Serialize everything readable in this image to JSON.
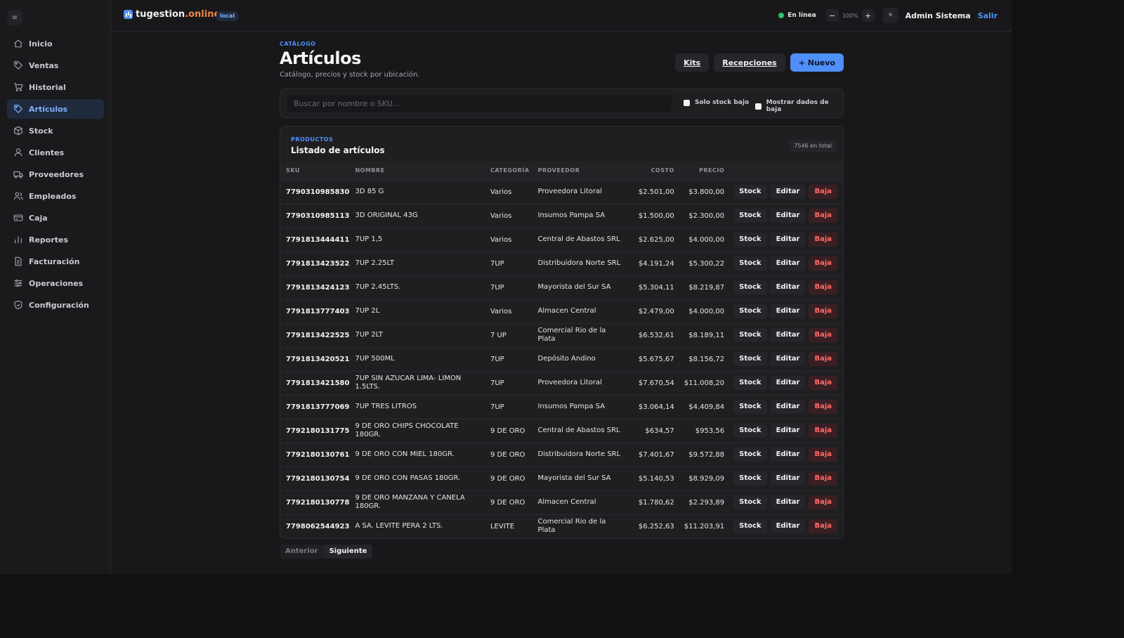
{
  "topbar": {
    "menu_glyph": "≡",
    "brand_a": "tugestion",
    "brand_b": ".online",
    "env": "local",
    "status": "En línea",
    "zoom_out": "−",
    "zoom": "100%",
    "zoom_in": "+",
    "theme_glyph": "☀",
    "user": "Admin Sistema",
    "logout": "Salir"
  },
  "sidebar": {
    "items": [
      {
        "label": "Inicio",
        "icon": "home-icon"
      },
      {
        "label": "Ventas",
        "icon": "tag-icon"
      },
      {
        "label": "Historial",
        "icon": "cart-icon"
      },
      {
        "label": "Artículos",
        "icon": "tag-icon",
        "active": true
      },
      {
        "label": "Stock",
        "icon": "box-icon"
      },
      {
        "label": "Clientes",
        "icon": "user-icon"
      },
      {
        "label": "Proveedores",
        "icon": "truck-icon"
      },
      {
        "label": "Empleados",
        "icon": "users-icon"
      },
      {
        "label": "Caja",
        "icon": "card-icon"
      },
      {
        "label": "Reportes",
        "icon": "chart-icon"
      },
      {
        "label": "Facturación",
        "icon": "file-icon"
      },
      {
        "label": "Operaciones",
        "icon": "sliders-icon"
      },
      {
        "label": "Configuración",
        "icon": "shield-icon"
      }
    ]
  },
  "page": {
    "eyebrow": "CATÁLOGO",
    "title": "Artículos",
    "subtitle": "Catálogo, precios y stock por ubicación.",
    "btn_kits": "Kits",
    "btn_recepciones": "Recepciones",
    "btn_nuevo": "+ Nuevo"
  },
  "filters": {
    "search_placeholder": "Buscar por nombre o SKU...",
    "low_stock": "Solo stock bajo",
    "show_deleted": "Mostrar dados de baja"
  },
  "table": {
    "eyebrow": "PRODUCTOS",
    "title": "Listado de artículos",
    "total": "7546 en total",
    "headers": {
      "sku": "SKU",
      "nombre": "NOMBRE",
      "categoria": "CATEGORÍA",
      "proveedor": "PROVEEDOR",
      "costo": "COSTO",
      "precio": "PRECIO"
    },
    "action_labels": {
      "stock": "Stock",
      "editar": "Editar",
      "baja": "Baja"
    },
    "rows": [
      {
        "sku": "7790310985830",
        "nombre": "3D 85 G",
        "categoria": "Varios",
        "proveedor": "Proveedora Litoral",
        "costo": "$2.501,00",
        "precio": "$3.800,00"
      },
      {
        "sku": "7790310985113",
        "nombre": "3D ORIGINAL 43G",
        "categoria": "Varios",
        "proveedor": "Insumos Pampa SA",
        "costo": "$1.500,00",
        "precio": "$2.300,00"
      },
      {
        "sku": "7791813444411",
        "nombre": "7UP 1,5",
        "categoria": "Varios",
        "proveedor": "Central de Abastos SRL",
        "costo": "$2.625,00",
        "precio": "$4.000,00"
      },
      {
        "sku": "7791813423522",
        "nombre": "7UP 2.25LT",
        "categoria": "7UP",
        "proveedor": "Distribuidora Norte SRL",
        "costo": "$4.191,24",
        "precio": "$5.300,22"
      },
      {
        "sku": "7791813424123",
        "nombre": "7UP 2.45LTS.",
        "categoria": "7UP",
        "proveedor": "Mayorista del Sur SA",
        "costo": "$5.304,11",
        "precio": "$8.219,87"
      },
      {
        "sku": "7791813777403",
        "nombre": "7UP 2L",
        "categoria": "Varios",
        "proveedor": "Almacen Central",
        "costo": "$2.479,00",
        "precio": "$4.000,00"
      },
      {
        "sku": "7791813422525",
        "nombre": "7UP 2LT",
        "categoria": "7 UP",
        "proveedor": "Comercial Rio de la Plata",
        "costo": "$6.532,61",
        "precio": "$8.189,11"
      },
      {
        "sku": "7791813420521",
        "nombre": "7UP 500ML",
        "categoria": "7UP",
        "proveedor": "Depósito Andino",
        "costo": "$5.675,67",
        "precio": "$8.156,72"
      },
      {
        "sku": "7791813421580",
        "nombre": "7UP SIN AZUCAR LIMA- LIMON 1.5LTS.",
        "categoria": "7UP",
        "proveedor": "Proveedora Litoral",
        "costo": "$7.670,54",
        "precio": "$11.008,20"
      },
      {
        "sku": "7791813777069",
        "nombre": "7UP TRES LITROS",
        "categoria": "7UP",
        "proveedor": "Insumos Pampa SA",
        "costo": "$3.064,14",
        "precio": "$4.409,84"
      },
      {
        "sku": "7792180131775",
        "nombre": "9 DE ORO CHIPS CHOCOLATE 180GR.",
        "categoria": "9 DE ORO",
        "proveedor": "Central de Abastos SRL",
        "costo": "$634,57",
        "precio": "$953,56"
      },
      {
        "sku": "7792180130761",
        "nombre": "9 DE ORO CON MIEL 180GR.",
        "categoria": "9 DE ORO",
        "proveedor": "Distribuidora Norte SRL",
        "costo": "$7.401,67",
        "precio": "$9.572,88"
      },
      {
        "sku": "7792180130754",
        "nombre": "9 DE ORO CON PASAS 180GR.",
        "categoria": "9 DE ORO",
        "proveedor": "Mayorista del Sur SA",
        "costo": "$5.140,53",
        "precio": "$8.929,09"
      },
      {
        "sku": "7792180130778",
        "nombre": "9 DE ORO MANZANA Y CANELA 180GR.",
        "categoria": "9 DE ORO",
        "proveedor": "Almacen Central",
        "costo": "$1.780,62",
        "precio": "$2.293,89"
      },
      {
        "sku": "7798062544923",
        "nombre": "A SA. LEVITE PERA 2 LTS.",
        "categoria": "LEVITE",
        "proveedor": "Comercial Rio de la Plata",
        "costo": "$6.252,63",
        "precio": "$11.203,91"
      }
    ]
  },
  "pager": {
    "prev": "Anterior",
    "next": "Siguiente"
  }
}
